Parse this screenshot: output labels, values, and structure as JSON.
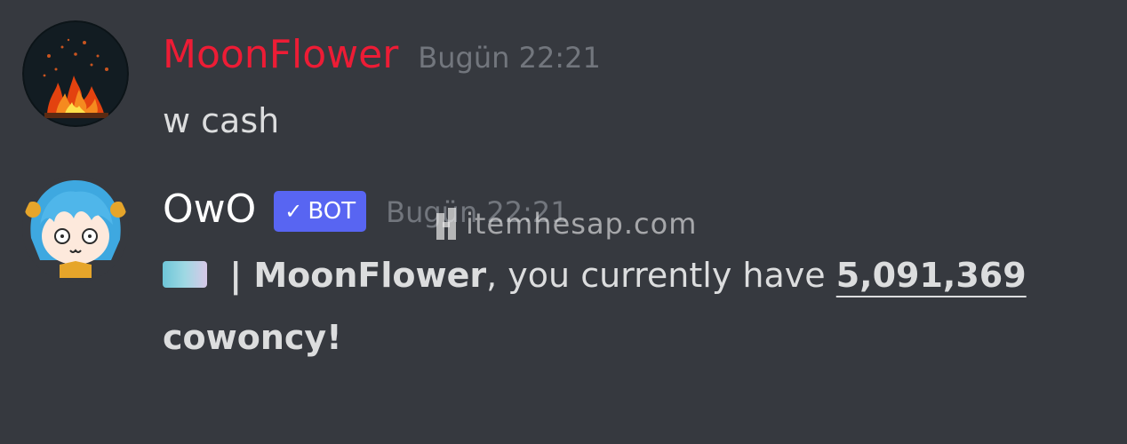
{
  "messages": [
    {
      "username": "MoonFlower",
      "username_color": "#ed1c35",
      "timestamp": "Bugün 22:21",
      "text": "w cash",
      "avatar_icon": "fire-avatar-icon"
    },
    {
      "username": "OwO",
      "username_color": "#ffffff",
      "badge": "BOT",
      "badge_icon": "checkmark-icon",
      "timestamp": "Bugün 22:21",
      "avatar_icon": "owo-anime-avatar-icon",
      "emoji": "cash-emoji-icon",
      "separator": " | ",
      "mention_name": "MoonFlower",
      "text_mid": ", you currently have ",
      "amount": "5,091,369",
      "text_end": "cowoncy!"
    }
  ],
  "watermark": {
    "text": "itemhesap.com",
    "icon": "itemhesap-logo-icon"
  },
  "colors": {
    "background": "#36393f",
    "timestamp": "#72767d",
    "text": "#dcddde",
    "bot_badge": "#5865f2"
  }
}
